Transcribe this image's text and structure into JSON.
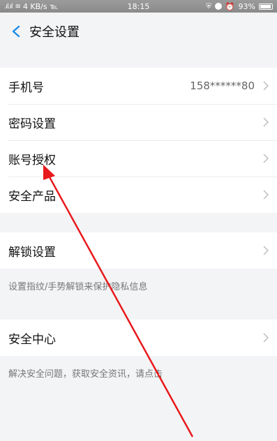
{
  "status_bar": {
    "network_speed": "4 KB/s",
    "time": "18:15",
    "battery": "93%"
  },
  "header": {
    "title": "安全设置"
  },
  "group1": {
    "phone_label": "手机号",
    "phone_value": "158******80",
    "password_label": "密码设置",
    "account_auth_label": "账号授权",
    "security_products_label": "安全产品"
  },
  "group2": {
    "unlock_label": "解锁设置",
    "unlock_note": "设置指纹/手势解锁来保护隐私信息"
  },
  "group3": {
    "center_label": "安全中心",
    "center_note": "解决安全问题，获取安全资讯，请点击"
  },
  "annotation": {
    "arrow_color": "#e8191c"
  }
}
